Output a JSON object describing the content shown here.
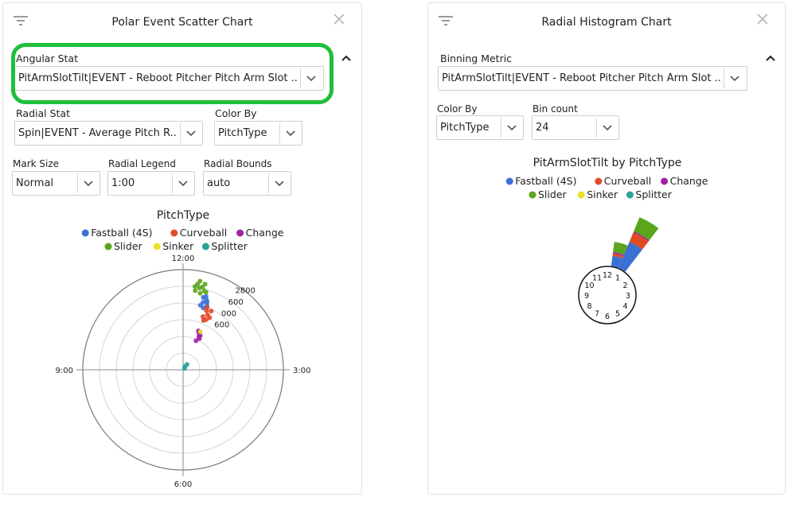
{
  "left_panel": {
    "title": "Polar Event Scatter Chart",
    "angular_stat": {
      "label": "Angular Stat",
      "value": "PitArmSlotTilt|EVENT - Reboot Pitcher Pitch Arm Slot ..."
    },
    "radial_stat": {
      "label": "Radial Stat",
      "value": "Spin|EVENT - Average Pitch R..."
    },
    "color_by": {
      "label": "Color By",
      "value": "PitchType"
    },
    "mark_size": {
      "label": "Mark Size",
      "value": "Normal"
    },
    "radial_legend": {
      "label": "Radial Legend",
      "value": "1:00"
    },
    "radial_bounds": {
      "label": "Radial Bounds",
      "value": "auto"
    }
  },
  "right_panel": {
    "title": "Radial Histogram Chart",
    "binning_metric": {
      "label": "Binning Metric",
      "value": "PitArmSlotTilt|EVENT - Reboot Pitcher Pitch Arm Slot ..."
    },
    "color_by": {
      "label": "Color By",
      "value": "PitchType"
    },
    "bin_count": {
      "label": "Bin count",
      "value": "24"
    }
  },
  "colors": {
    "highlight": "#1fbf3a",
    "Fastball (4S)": "#3b6fd4",
    "Curveball": "#e04a25",
    "Change": "#a020a8",
    "Slider": "#5aa51c",
    "Sinker": "#e8e22b",
    "Splitter": "#2aa39a"
  },
  "chart_data": [
    {
      "type": "scatter",
      "coordinate_system": "polar",
      "title": "PitchType",
      "legend": [
        "Fastball (4S)",
        "Curveball",
        "Change",
        "Slider",
        "Sinker",
        "Splitter"
      ],
      "legend_position": "top",
      "angle_labels": [
        "12:00",
        "3:00",
        "6:00",
        "9:00"
      ],
      "radial_ticks": [
        1600,
        2000,
        2400,
        2800
      ],
      "radial_tick_labels": [
        "600",
        "000",
        "600",
        "2800"
      ],
      "radial_range": [
        0,
        3000
      ],
      "grid": true,
      "series": [
        {
          "name": "Slider",
          "points": [
            {
              "angle": 0.32,
              "r": 2600
            },
            {
              "angle": 0.38,
              "r": 2500
            },
            {
              "angle": 0.44,
              "r": 2550
            },
            {
              "angle": 0.29,
              "r": 2400
            },
            {
              "angle": 0.5,
              "r": 2450
            },
            {
              "angle": 0.36,
              "r": 2700
            },
            {
              "angle": 0.42,
              "r": 2350
            },
            {
              "angle": 0.48,
              "r": 2650
            },
            {
              "angle": 0.27,
              "r": 2520
            },
            {
              "angle": 0.55,
              "r": 2420
            }
          ]
        },
        {
          "name": "Fastball (4S)",
          "points": [
            {
              "angle": 0.55,
              "r": 2100
            },
            {
              "angle": 0.62,
              "r": 2200
            },
            {
              "angle": 0.5,
              "r": 2000
            },
            {
              "angle": 0.58,
              "r": 2300
            },
            {
              "angle": 0.65,
              "r": 2150
            },
            {
              "angle": 0.52,
              "r": 2250
            },
            {
              "angle": 0.6,
              "r": 1950
            },
            {
              "angle": 0.68,
              "r": 2050
            }
          ]
        },
        {
          "name": "Curveball",
          "points": [
            {
              "angle": 0.72,
              "r": 1900
            },
            {
              "angle": 0.8,
              "r": 1800
            },
            {
              "angle": 0.68,
              "r": 1700
            },
            {
              "angle": 0.85,
              "r": 1950
            },
            {
              "angle": 0.75,
              "r": 1600
            },
            {
              "angle": 0.9,
              "r": 1750
            },
            {
              "angle": 0.7,
              "r": 2000
            },
            {
              "angle": 0.82,
              "r": 1650
            }
          ]
        },
        {
          "name": "Change",
          "points": [
            {
              "angle": 0.78,
              "r": 1200
            },
            {
              "angle": 0.85,
              "r": 1100
            },
            {
              "angle": 0.72,
              "r": 1250
            },
            {
              "angle": 0.92,
              "r": 1050
            },
            {
              "angle": 0.8,
              "r": 950
            },
            {
              "angle": 0.88,
              "r": 1150
            }
          ]
        },
        {
          "name": "Sinker",
          "points": [
            {
              "angle": 0.82,
              "r": 1250
            }
          ]
        },
        {
          "name": "Splitter",
          "points": [
            {
              "angle": 1.2,
              "r": 200
            },
            {
              "angle": 1.0,
              "r": 120
            },
            {
              "angle": 1.5,
              "r": 60
            }
          ]
        }
      ]
    },
    {
      "type": "bar",
      "coordinate_system": "polar",
      "title": "PitArmSlotTilt by PitchType",
      "legend": [
        "Fastball (4S)",
        "Curveball",
        "Change",
        "Slider",
        "Sinker",
        "Splitter"
      ],
      "legend_position": "top",
      "hour_labels": [
        "12",
        "1",
        "2",
        "3",
        "4",
        "5",
        "6",
        "7",
        "8",
        "9",
        "10",
        "11"
      ],
      "bin_count": 24,
      "bins": [
        {
          "angle_hours": 0.5,
          "stack": [
            {
              "name": "Fastball (4S)",
              "count": 4
            },
            {
              "name": "Curveball",
              "count": 1
            },
            {
              "name": "Change",
              "count": 0.5
            },
            {
              "name": "Slider",
              "count": 4
            }
          ]
        },
        {
          "angle_hours": 1.0,
          "stack": [
            {
              "name": "Fastball (4S)",
              "count": 11
            },
            {
              "name": "Curveball",
              "count": 4
            },
            {
              "name": "Change",
              "count": 0.5
            },
            {
              "name": "Slider",
              "count": 6
            }
          ]
        }
      ]
    }
  ]
}
